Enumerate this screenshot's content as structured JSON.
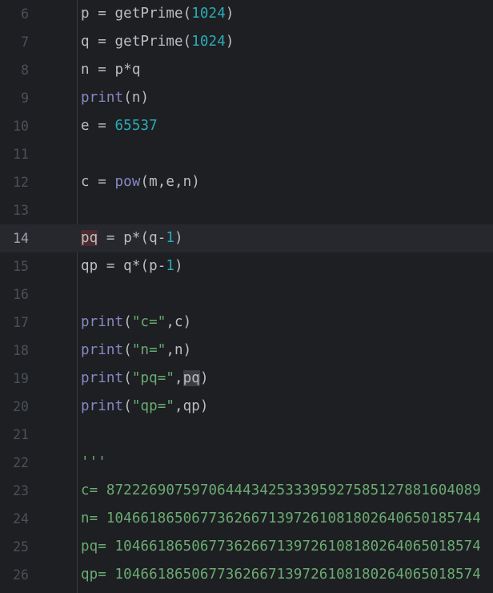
{
  "colors": {
    "background": "#1e1f22",
    "current_line": "#26282e",
    "text": "#bcbec4",
    "gutter": "#4b5059",
    "number": "#2aacb8",
    "builtin": "#8888c6",
    "string": "#6aab73"
  },
  "current_line_number": "14",
  "lines": [
    {
      "n": "6",
      "tokens": [
        {
          "t": "p = getPrime("
        },
        {
          "t": "1024",
          "c": "num"
        },
        {
          "t": ")"
        }
      ]
    },
    {
      "n": "7",
      "tokens": [
        {
          "t": "q = getPrime("
        },
        {
          "t": "1024",
          "c": "num"
        },
        {
          "t": ")"
        }
      ]
    },
    {
      "n": "8",
      "tokens": [
        {
          "t": "n = p*q"
        }
      ]
    },
    {
      "n": "9",
      "tokens": [
        {
          "t": "print",
          "c": "builtin"
        },
        {
          "t": "(n)"
        }
      ]
    },
    {
      "n": "10",
      "tokens": [
        {
          "t": "e = "
        },
        {
          "t": "65537",
          "c": "num"
        }
      ]
    },
    {
      "n": "11",
      "tokens": []
    },
    {
      "n": "12",
      "tokens": [
        {
          "t": "c = "
        },
        {
          "t": "pow",
          "c": "builtin"
        },
        {
          "t": "(m,e,n)"
        }
      ]
    },
    {
      "n": "13",
      "tokens": []
    },
    {
      "n": "14",
      "tokens": [
        {
          "t": "pq",
          "c": "hl-red"
        },
        {
          "t": " = p*(q-"
        },
        {
          "t": "1",
          "c": "num"
        },
        {
          "t": ")"
        }
      ]
    },
    {
      "n": "15",
      "tokens": [
        {
          "t": "qp = q*(p-"
        },
        {
          "t": "1",
          "c": "num"
        },
        {
          "t": ")"
        }
      ]
    },
    {
      "n": "16",
      "tokens": []
    },
    {
      "n": "17",
      "tokens": [
        {
          "t": "print",
          "c": "builtin"
        },
        {
          "t": "("
        },
        {
          "t": "\"c=\"",
          "c": "str"
        },
        {
          "t": ",c)"
        }
      ]
    },
    {
      "n": "18",
      "tokens": [
        {
          "t": "print",
          "c": "builtin"
        },
        {
          "t": "("
        },
        {
          "t": "\"n=\"",
          "c": "str"
        },
        {
          "t": ",n)"
        }
      ]
    },
    {
      "n": "19",
      "tokens": [
        {
          "t": "print",
          "c": "builtin"
        },
        {
          "t": "("
        },
        {
          "t": "\"pq=\"",
          "c": "str"
        },
        {
          "t": ","
        },
        {
          "t": "pq",
          "c": "hl-gray"
        },
        {
          "t": ")"
        }
      ]
    },
    {
      "n": "20",
      "tokens": [
        {
          "t": "print",
          "c": "builtin"
        },
        {
          "t": "("
        },
        {
          "t": "\"qp=\"",
          "c": "str"
        },
        {
          "t": ",qp)"
        }
      ]
    },
    {
      "n": "21",
      "tokens": []
    },
    {
      "n": "22",
      "tokens": [
        {
          "t": "'''",
          "c": "str"
        }
      ]
    },
    {
      "n": "23",
      "tokens": [
        {
          "t": "c= 87222690759706444342533395927585127881604089",
          "c": "str"
        }
      ]
    },
    {
      "n": "24",
      "tokens": [
        {
          "t": "n= 10466186506773626671397261081802640650185744",
          "c": "str"
        }
      ]
    },
    {
      "n": "25",
      "tokens": [
        {
          "t": "pq= 1046618650677362667139726108180264065018574",
          "c": "str"
        }
      ]
    },
    {
      "n": "26",
      "tokens": [
        {
          "t": "qp= 1046618650677362667139726108180264065018574",
          "c": "str"
        }
      ]
    }
  ]
}
